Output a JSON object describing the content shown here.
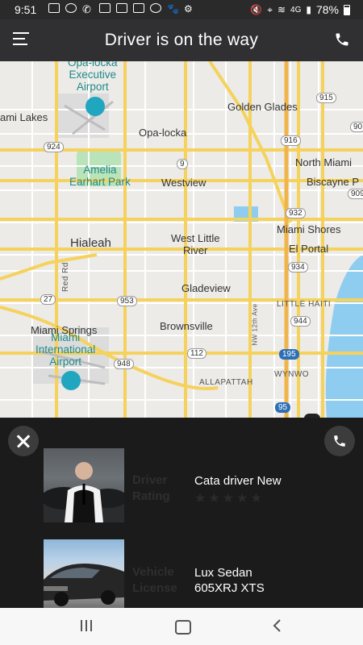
{
  "status_bar": {
    "time": "9:51",
    "battery": "78%",
    "network": "4G"
  },
  "header": {
    "title": "Driver is on the way"
  },
  "map": {
    "labels": {
      "opa_locka_airport": "Opa-locka\nExecutive\nAirport",
      "miami_lakes": "ami Lakes",
      "golden_glades": "Golden Glades",
      "opa_locka": "Opa-locka",
      "north_miami": "North Miami",
      "amelia": "Amelia\nEarhart Park",
      "westview": "Westview",
      "biscayne": "Biscayne P",
      "hialeah": "Hialeah",
      "west_little_river": "West Little\nRiver",
      "miami_shores": "Miami Shores",
      "el_portal": "El Portal",
      "red_rd": "Red Rd",
      "gladeview": "Gladeview",
      "little_haiti": "LITTLE HAITI",
      "miami_springs": "Miami Springs",
      "brownsville": "Brownsville",
      "nw_12th": "NW 12th Ave",
      "mia": "Miami\nInternational\nAirport",
      "allapattah": "ALLAPATTAH",
      "wynwood": "WYNWO"
    },
    "shields": {
      "s915": "915",
      "s90": "90",
      "s924": "924",
      "s916": "916",
      "s9": "9",
      "s909": "909",
      "s932": "932",
      "s934": "934",
      "s27": "27",
      "s953": "953",
      "s944": "944",
      "s195": "195",
      "s112": "112",
      "s948": "948",
      "s95": "95"
    }
  },
  "driver": {
    "label": "Driver\nRating",
    "name": "Cata  driver New",
    "rating_stars": "★★★★★",
    "rating": 0
  },
  "vehicle": {
    "label": "Vehicle\nLicense",
    "model": "Lux Sedan",
    "license": "605XRJ XTS"
  },
  "colors": {
    "header_bg": "#303032",
    "sheet_bg": "#1b1b1b",
    "map_bg": "#ecebe8",
    "road_yellow": "#f5d25c",
    "water": "#8fcdf0",
    "park": "#b9e3b9",
    "marker_blue": "#3f7ed6"
  }
}
